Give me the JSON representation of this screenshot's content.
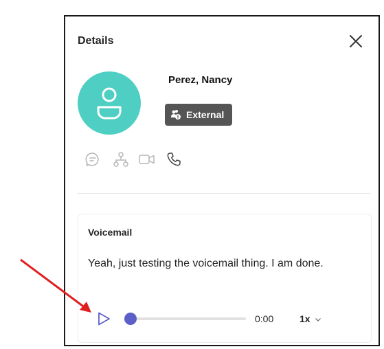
{
  "panel": {
    "title": "Details",
    "close_icon": "close-icon"
  },
  "contact": {
    "name": "Perez, Nancy",
    "avatar_color": "#4fcfc3",
    "badge_label": "External",
    "badge_color": "#555555"
  },
  "actions": [
    {
      "icon": "chat-icon"
    },
    {
      "icon": "org-chart-icon"
    },
    {
      "icon": "video-call-icon"
    },
    {
      "icon": "phone-call-icon"
    }
  ],
  "voicemail": {
    "title": "Voicemail",
    "transcript": "Yeah, just testing the voicemail thing. I am done.",
    "player": {
      "play_icon": "play-icon",
      "progress": 0,
      "time": "0:00",
      "speed": "1x",
      "accent_color": "#5b5fc7"
    }
  },
  "annotation": {
    "arrow_color": "#e02020"
  }
}
